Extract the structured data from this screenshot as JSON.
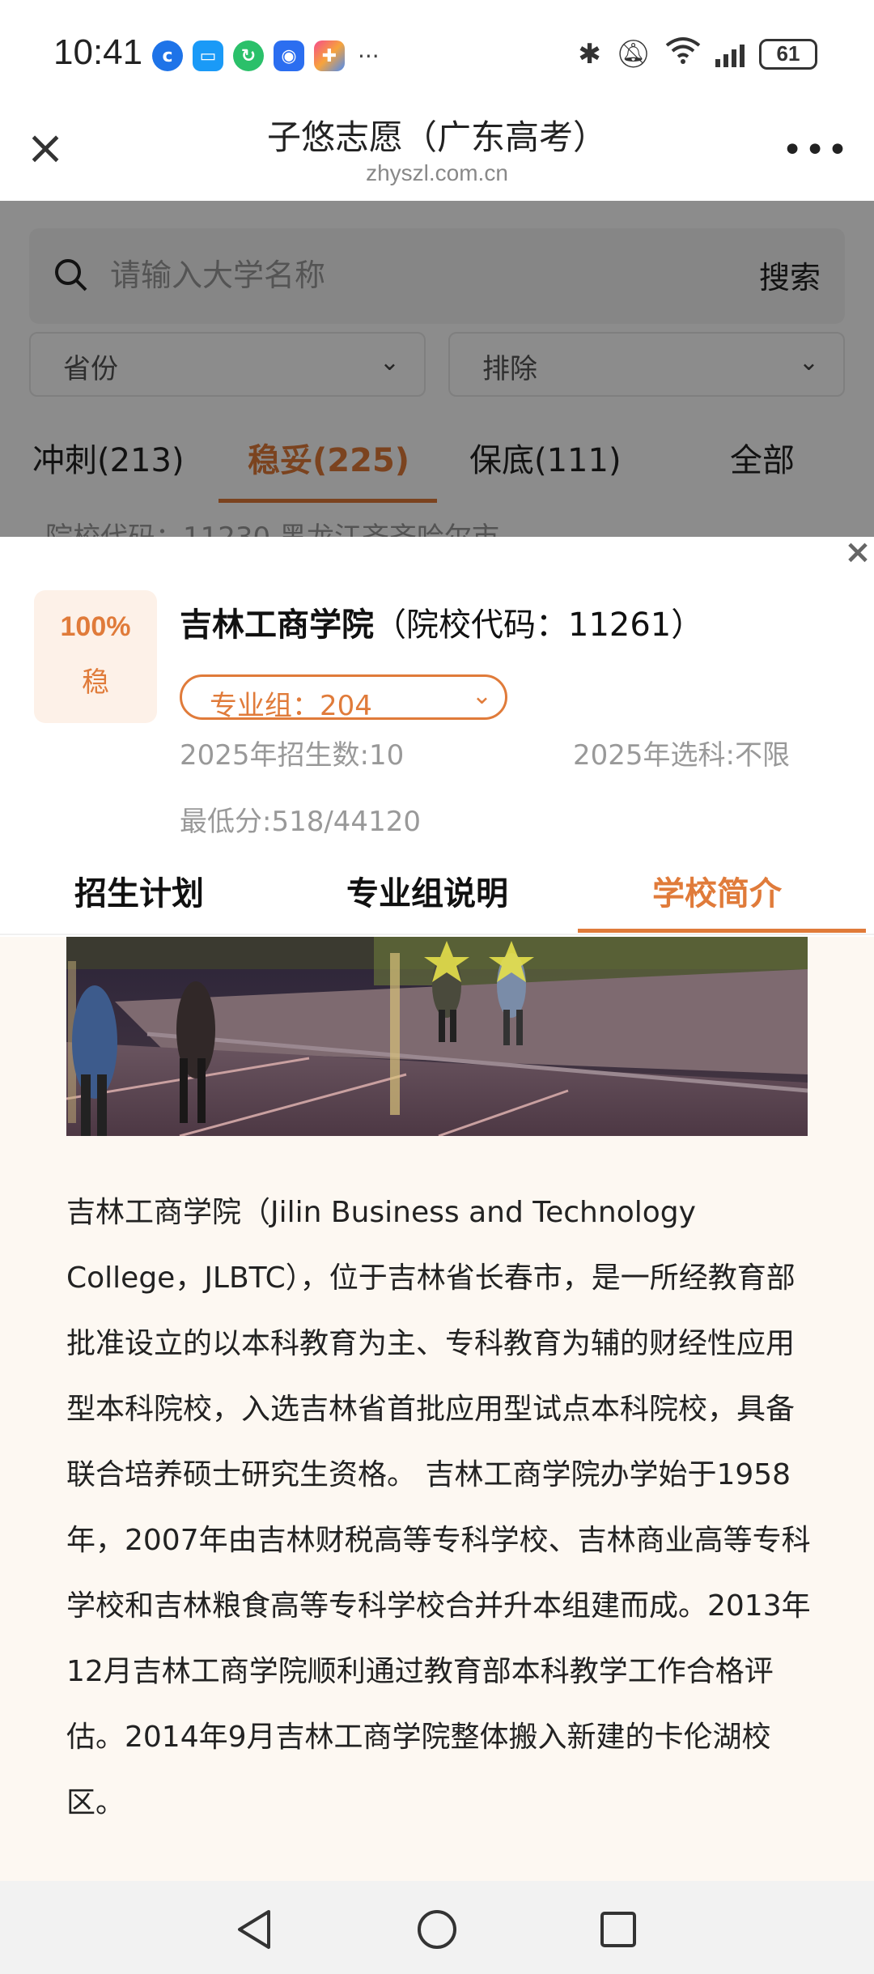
{
  "status": {
    "time": "10:41",
    "battery": "61",
    "more": "···"
  },
  "titlebar": {
    "title": "子悠志愿（广东高考）",
    "url": "zhyszl.com.cn"
  },
  "search": {
    "placeholder": "请输入大学名称",
    "button": "搜索"
  },
  "filters": {
    "province": "省份",
    "exclude": "排除"
  },
  "tabs": [
    {
      "label": "冲刺(213)"
    },
    {
      "label": "稳妥(225)"
    },
    {
      "label": "保底(111)"
    },
    {
      "label": "全部"
    }
  ],
  "background_peek": "院校代码：11230    黑龙江齐齐哈尔市",
  "school": {
    "probability": "100%",
    "probability_label": "稳",
    "name": "吉林工商学院",
    "code": "（院校代码：11261）",
    "group": "专业组：204",
    "enrollment": "2025年招生数:10",
    "subjects": "2025年选科:不限",
    "min_score": "最低分:518/44120"
  },
  "sheet_tabs": [
    {
      "label": "招生计划"
    },
    {
      "label": "专业组说明"
    },
    {
      "label": "学校简介"
    }
  ],
  "description": "吉林工商学院（Jilin Business and Technology College，JLBTC），位于吉林省长春市，是一所经教育部批准设立的以本科教育为主、专科教育为辅的财经性应用型本科院校，入选吉林省首批应用型试点本科院校，具备联合培养硕士研究生资格。 吉林工商学院办学始于1958年，2007年由吉林财税高等专科学校、吉林商业高等专科学校和吉林粮食高等专科学校合并升本组建而成。2013年12月吉林工商学院顺利通过教育部本科教学工作合格评估。2014年9月吉林工商学院整体搬入新建的卡伦湖校区。",
  "colors": {
    "accent": "#e07b3a",
    "accent_bg": "#fdf1e8"
  }
}
